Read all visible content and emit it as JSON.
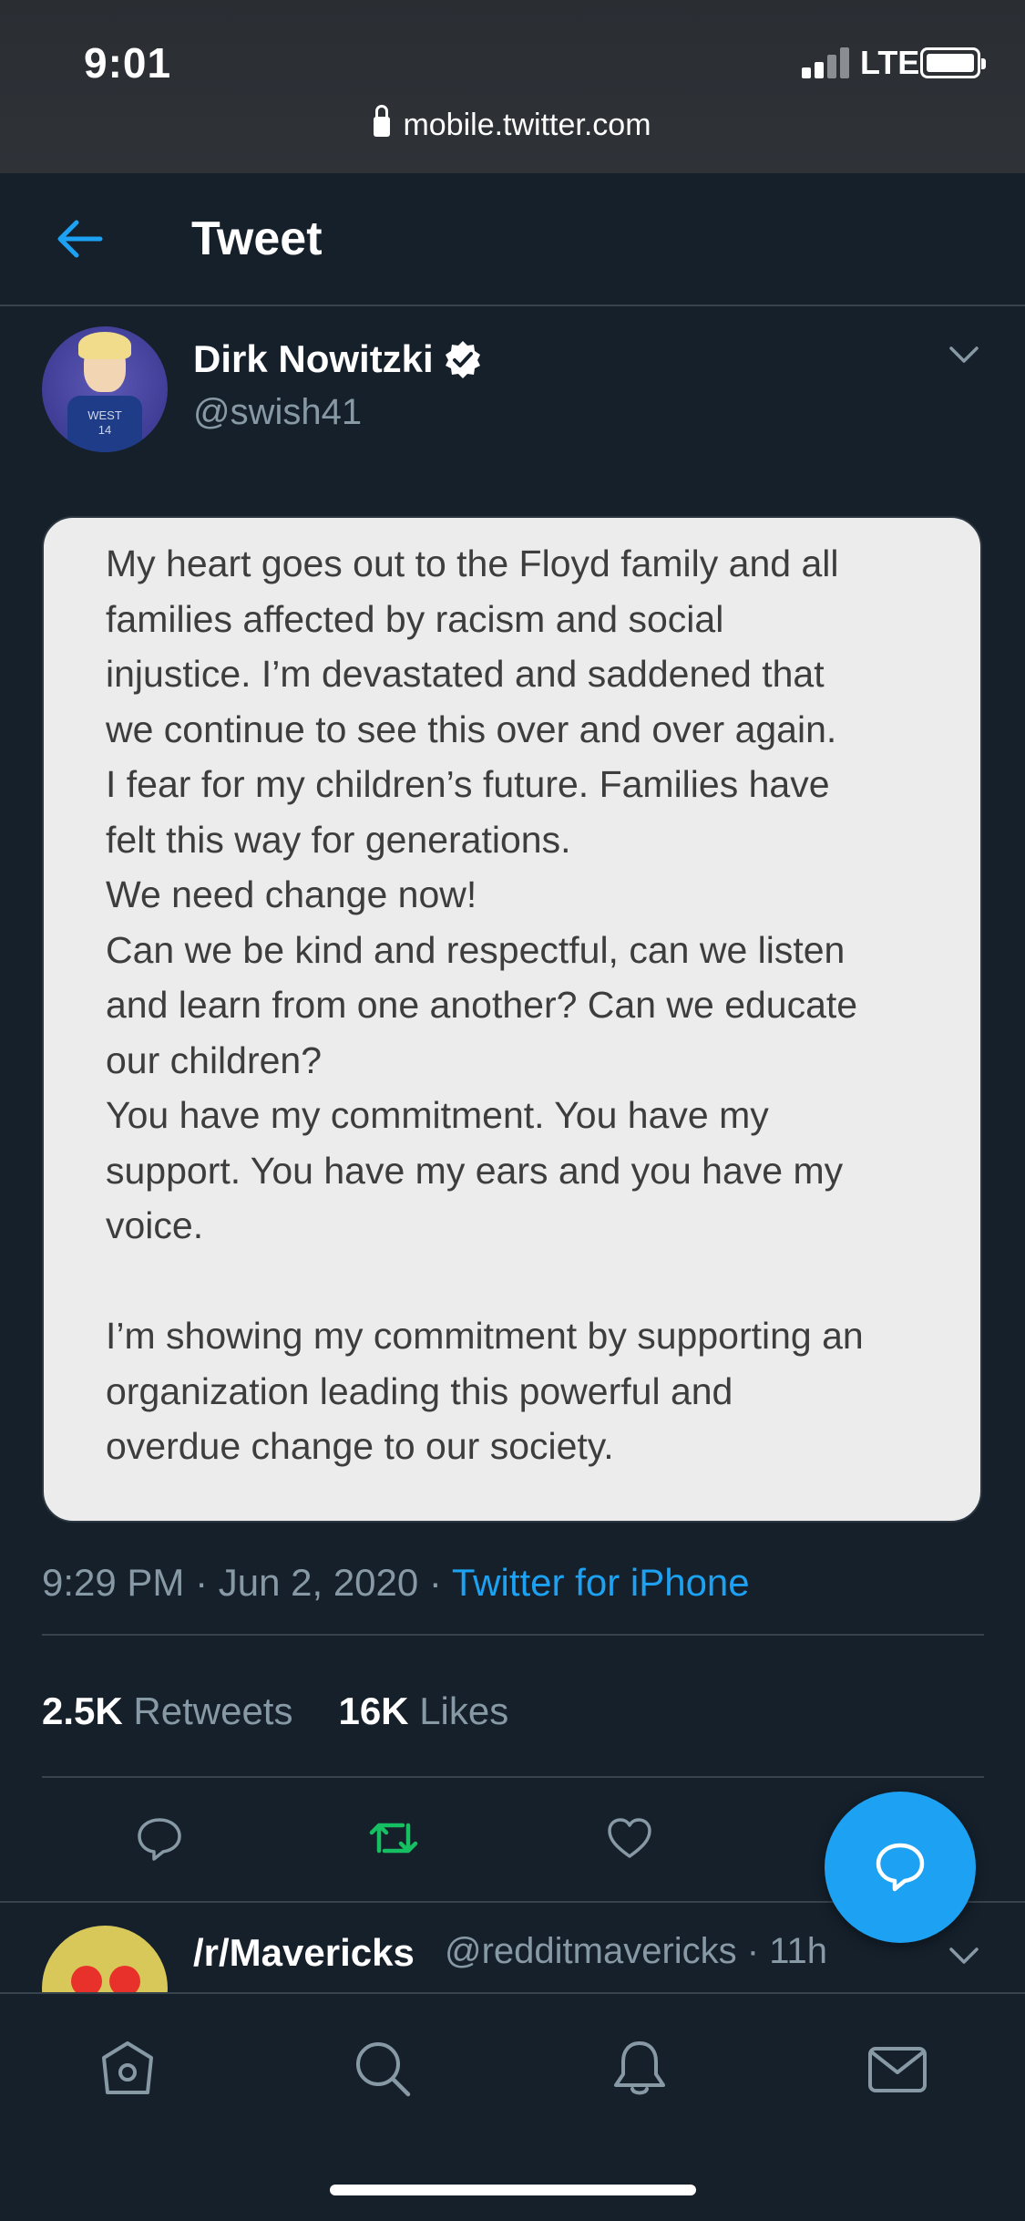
{
  "status": {
    "time": "9:01",
    "network": "LTE"
  },
  "browser": {
    "url": "mobile.twitter.com"
  },
  "header": {
    "title": "Tweet"
  },
  "tweet": {
    "author_name": "Dirk Nowitzki",
    "handle": "@swish41",
    "avatar_jersey": "WEST\n14",
    "image_text": "My heart goes out to the Floyd family and all\nfamilies affected by racism and social\ninjustice. I’m devastated and saddened that\nwe continue to see this over and over again.\nI fear for my children’s future. Families have\nfelt this way for generations.\nWe need change now!\nCan we be kind and respectful, can we listen\nand learn from one another? Can we educate\nour children?\nYou have my commitment. You have my\nsupport. You have my ears and you have my\nvoice.\n\nI’m showing my commitment by supporting an\norganization leading this powerful and\noverdue change to our society.",
    "timestamp": "9:29 PM · Jun 2, 2020 · ",
    "source": "Twitter for iPhone",
    "retweets_count": "2.5K",
    "retweets_label": "Retweets",
    "likes_count": "16K",
    "likes_label": "Likes"
  },
  "next_tweet": {
    "author_name": "/r/Mavericks",
    "handle_time": "@redditmavericks · 11h"
  },
  "tabs": [
    "home-icon",
    "search-icon",
    "notifications-icon",
    "messages-icon"
  ],
  "colors": {
    "background": "#15202b",
    "accent": "#1da1f2",
    "retweet": "#17bf63",
    "muted": "#8899a6",
    "divider": "#38444d"
  }
}
